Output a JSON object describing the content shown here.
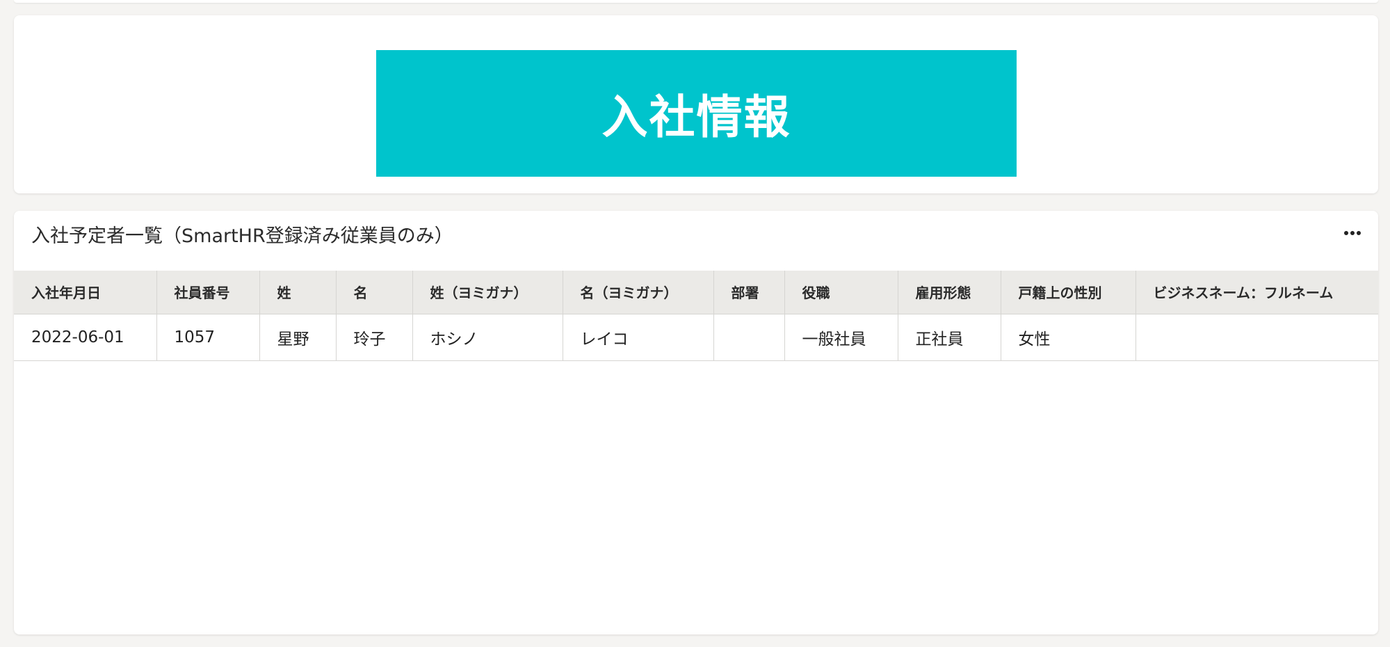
{
  "banner": {
    "title": "入社情報",
    "background_color": "#00c4cc"
  },
  "table": {
    "title": "入社予定者一覧（SmartHR登録済み従業員のみ）",
    "more_icon": "more-horizontal-icon",
    "columns": [
      "入社年月日",
      "社員番号",
      "姓",
      "名",
      "姓（ヨミガナ）",
      "名（ヨミガナ）",
      "部署",
      "役職",
      "雇用形態",
      "戸籍上の性別",
      "ビジネスネーム：フルネーム"
    ],
    "rows": [
      [
        "2022-06-01",
        "1057",
        "星野",
        "玲子",
        "ホシノ",
        "レイコ",
        "",
        "一般社員",
        "正社員",
        "女性",
        ""
      ]
    ]
  }
}
